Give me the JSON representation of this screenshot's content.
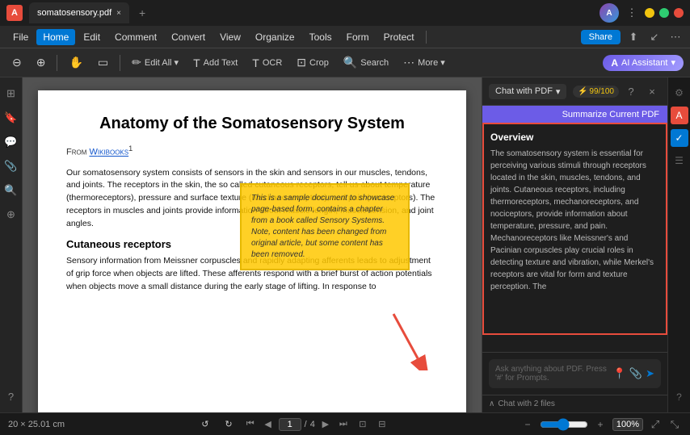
{
  "app": {
    "icon": "A",
    "tab": {
      "filename": "somatosensory.pdf",
      "close_label": "×",
      "new_tab_label": "+"
    }
  },
  "title_bar": {
    "controls": {
      "kebab": "⋮",
      "minimize": "_",
      "maximize": "□",
      "close": "×"
    },
    "avatar_initials": "A"
  },
  "menu_bar": {
    "items": [
      "File",
      "Home",
      "Edit",
      "Comment",
      "Convert",
      "View",
      "Organize",
      "Tools",
      "Form",
      "Protect"
    ],
    "active_item": "Home",
    "right": {
      "share_label": "Share",
      "icons": [
        "⬆",
        "↙",
        "⋯"
      ]
    }
  },
  "toolbar": {
    "tools": [
      {
        "id": "zoom-out",
        "icon": "⊖",
        "label": ""
      },
      {
        "id": "zoom-in",
        "icon": "⊕",
        "label": ""
      },
      {
        "id": "hand",
        "icon": "✋",
        "label": ""
      },
      {
        "id": "select",
        "icon": "▭",
        "label": ""
      },
      {
        "id": "edit-all",
        "icon": "✏",
        "label": "Edit All"
      },
      {
        "id": "add-text",
        "icon": "T",
        "label": "Add Text"
      },
      {
        "id": "ocr",
        "icon": "T",
        "label": "OCR"
      },
      {
        "id": "crop",
        "icon": "⊡",
        "label": "Crop"
      },
      {
        "id": "search",
        "icon": "🔍",
        "label": "Search"
      },
      {
        "id": "more",
        "icon": "⋯",
        "label": "More"
      }
    ],
    "ai_btn_label": "AI Assistant",
    "ai_icon": "A"
  },
  "pdf": {
    "title": "Anatomy of the Somatosensory System",
    "from_line": "From Wikibooks",
    "superscript": "1",
    "paragraphs": [
      "Our somatosensory system consists of sensors in the skin and sensors in our muscles, tendons, and joints. The receptors in the skin, the so called cutaneous receptors, tell us about temperature (thermoreceptors), pressure and surface texture (mechano receptors), and pain (nociceptors). The receptors in muscles and joints provide information about muscle length, muscle tension, and joint angles.",
      "Sensory information from Meissner corpuscles and rapidly adapting afferents leads to adjustment of grip force when objects are lifted. These afferents respond with a brief burst of action potentials when objects move a small distance during the early stage of lifting. In response to"
    ],
    "heading": "Cutaneous receptors",
    "sample_overlay": "This is a sample document to showcase page-based form, contains a chapter from a book called Sensory Systems. Note, content has been changed from original article, but some content has been removed."
  },
  "right_panel": {
    "title": "Chat with PDF",
    "dropdown_icon": "▾",
    "score_label": "⚡ 99/100",
    "help_icon": "?",
    "close_icon": "×",
    "settings_icon": "⚙",
    "summarize_label": "Summarize Current PDF",
    "overview_title": "Overview",
    "overview_text": "The somatosensory system is essential for perceiving various stimuli through receptors located in the skin, muscles, tendons, and joints. Cutaneous receptors, including thermoreceptors, mechanoreceptors, and nociceptors, provide information about temperature, pressure, and pain. Mechanoreceptors like Meissner's and Pacinian corpuscles play crucial roles in detecting texture and vibration, while Merkel's receptors are vital for form and texture perception. The",
    "chat_placeholder": "Ask anything about PDF. Press '#' for Prompts.",
    "files_bar": "Chat with 2 files",
    "files_icon": "∧",
    "icon_buttons": {
      "location": "📍",
      "attach": "📎",
      "send": "➤"
    }
  },
  "right_sidebar": {
    "icons": [
      "⚙",
      "A",
      "✓",
      "☰",
      "?"
    ]
  },
  "status_bar": {
    "dimensions": "20 × 25.01 cm",
    "nav": {
      "first_icon": "⏮",
      "prev_icon": "◀",
      "current_page": "1",
      "separator": "/",
      "total_pages": "4",
      "next_icon": "▶",
      "last_icon": "⏭"
    },
    "view_icons": [
      "⊡",
      "⊟"
    ],
    "zoom_in_icon": "+",
    "zoom_out_icon": "-",
    "zoom_value": "100%",
    "fullscreen_icon": "⤢",
    "fit_icon": "⤡"
  }
}
